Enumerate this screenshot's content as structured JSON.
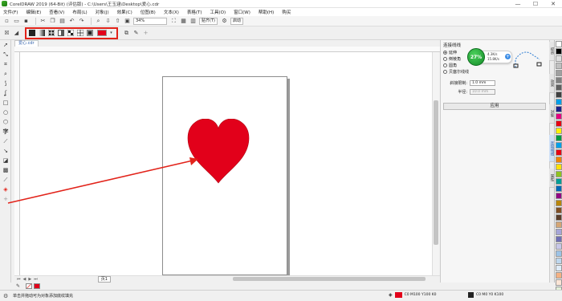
{
  "window": {
    "title": "CorelDRAW 2019 (64-Bit) (评估版) - C:\\Users\\王玉涵\\Desktop\\爱心.cdr",
    "minimize": "—",
    "maximize": "☐",
    "close": "✕"
  },
  "menu": [
    "文件(F)",
    "编辑(E)",
    "查看(V)",
    "布局(L)",
    "对象(J)",
    "效果(C)",
    "位图(B)",
    "文本(X)",
    "表格(T)",
    "工具(O)",
    "窗口(W)",
    "帮助(H)",
    "购买"
  ],
  "toolbar": {
    "zoom": "34%",
    "snap": "贴齐(T)",
    "launch": "启动"
  },
  "document": {
    "tab": "爱心.cdr",
    "page_tab": "页1",
    "fill_color": "#e2001a"
  },
  "docker": {
    "title": "连接线线",
    "options": [
      {
        "label": "延伸",
        "selected": true
      },
      {
        "label": "倒棱角",
        "selected": false
      },
      {
        "label": "圆角",
        "selected": false
      },
      {
        "label": "贝塞尔线线",
        "selected": false
      }
    ],
    "miter_label": "斜接限制:",
    "miter_value": "1.0 mm",
    "radius_label": "半径:",
    "radius_value": "10.0 mm",
    "apply": "应用"
  },
  "performance": {
    "percent": "27%",
    "up": "4.3K/s",
    "down": "15.8K/s"
  },
  "side_tabs": [
    "提示",
    "效果",
    "对象",
    "连接线线",
    "属性"
  ],
  "palette": [
    "#ffffff",
    "#000000",
    "#e0e0e0",
    "#c0c0c0",
    "#a0a0a0",
    "#808080",
    "#606060",
    "#404040",
    "#00a0e9",
    "#1d2088",
    "#e4007f",
    "#e60012",
    "#fff100",
    "#009944",
    "#00a0e9",
    "#e60012",
    "#f08300",
    "#ffe100",
    "#8fc31f",
    "#009e96",
    "#0068b7",
    "#920783",
    "#b8860b",
    "#7f4f24",
    "#5a3e2b",
    "#d4a574",
    "#a6a6d8",
    "#6f6fb5",
    "#c7c7e8",
    "#9cc3e6",
    "#bdd7ee",
    "#deebf7",
    "#f4b183",
    "#fbe5d6",
    "#e2f0d9",
    "#c5e0b4"
  ],
  "status": {
    "message": "单击并拖动可为对象添加底纹填充",
    "fill_info": "C0 M100 Y100 K0",
    "outline_info": "C0 M0 Y0 K100"
  }
}
